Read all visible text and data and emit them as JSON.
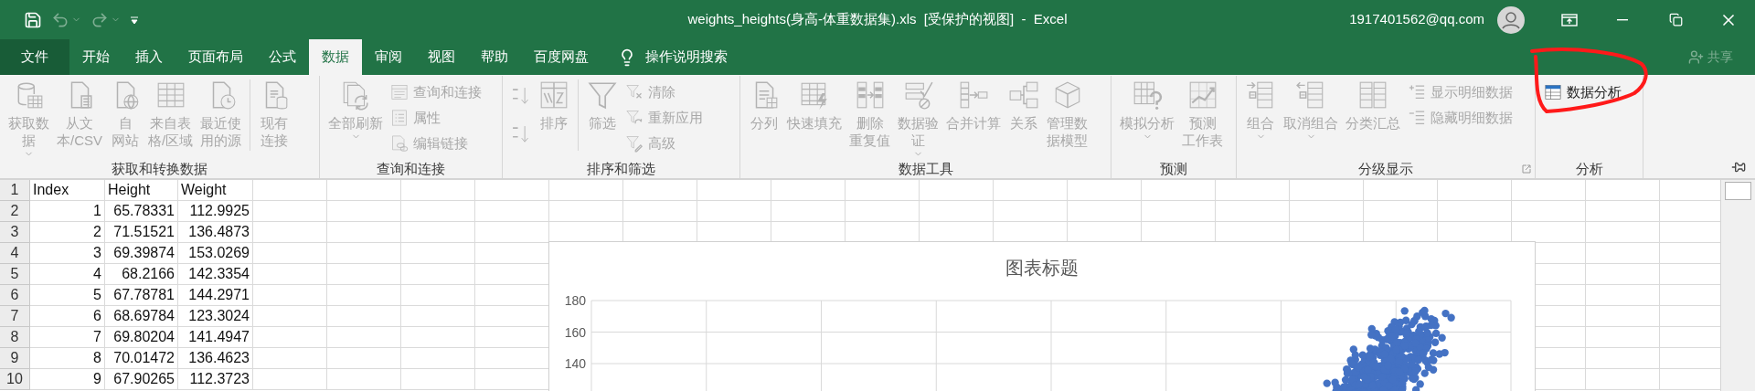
{
  "title_bar": {
    "quick_access": [
      {
        "kind": "save",
        "disabled": false,
        "dropdown": false
      },
      {
        "kind": "undo",
        "disabled": true,
        "dropdown": true
      },
      {
        "kind": "redo",
        "disabled": true,
        "dropdown": true
      },
      {
        "kind": "customize",
        "disabled": false,
        "dropdown": false
      }
    ],
    "title": "weights_heights(身高-体重数据集).xls  [受保护的视图]  -  Excel",
    "account": "1917401562@qq.com"
  },
  "ribbon_tabs": [
    {
      "label": "文件",
      "kind": "file",
      "selected": false
    },
    {
      "label": "开始",
      "kind": "tab",
      "selected": false
    },
    {
      "label": "插入",
      "kind": "tab",
      "selected": false
    },
    {
      "label": "页面布局",
      "kind": "tab",
      "selected": false
    },
    {
      "label": "公式",
      "kind": "tab",
      "selected": false
    },
    {
      "label": "数据",
      "kind": "tab",
      "selected": true
    },
    {
      "label": "审阅",
      "kind": "tab",
      "selected": false
    },
    {
      "label": "视图",
      "kind": "tab",
      "selected": false
    },
    {
      "label": "帮助",
      "kind": "tab",
      "selected": false
    },
    {
      "label": "百度网盘",
      "kind": "tab",
      "selected": false
    }
  ],
  "tell_me": "操作说明搜索",
  "share": {
    "label": "共享",
    "disabled": true
  },
  "ribbon_groups": [
    {
      "label": "获取和转换数据",
      "launcher": false,
      "items": [
        {
          "kind": "large",
          "label": "获取数据",
          "disabled": true,
          "dropdown": true
        },
        {
          "kind": "large",
          "label": "从文本/CSV",
          "disabled": true,
          "dropdown": false
        },
        {
          "kind": "large",
          "label": "自网站",
          "disabled": true,
          "dropdown": false
        },
        {
          "kind": "large",
          "label": "来自表格/区域",
          "disabled": true,
          "dropdown": false
        },
        {
          "kind": "large",
          "label": "最近使用的源",
          "disabled": true,
          "dropdown": false
        },
        {
          "kind": "separator"
        },
        {
          "kind": "large",
          "label": "现有连接",
          "disabled": true,
          "dropdown": false
        }
      ]
    },
    {
      "label": "查询和连接",
      "launcher": false,
      "items": [
        {
          "kind": "large",
          "label": "全部刷新",
          "disabled": true,
          "dropdown": true
        },
        {
          "kind": "stack",
          "buttons": [
            {
              "label": "查询和连接",
              "disabled": true
            },
            {
              "label": "属性",
              "disabled": true
            },
            {
              "label": "编辑链接",
              "disabled": true
            }
          ]
        }
      ]
    },
    {
      "label": "排序和筛选",
      "launcher": false,
      "items": [
        {
          "kind": "stack",
          "buttons": [
            {
              "disabled": true
            },
            {
              "disabled": true
            }
          ]
        },
        {
          "kind": "large",
          "label": "排序",
          "disabled": true,
          "dropdown": false
        },
        {
          "kind": "separator"
        },
        {
          "kind": "large",
          "label": "筛选",
          "disabled": true,
          "dropdown": false
        },
        {
          "kind": "stack",
          "buttons": [
            {
              "label": "清除",
              "disabled": true
            },
            {
              "label": "重新应用",
              "disabled": true
            },
            {
              "label": "高级",
              "disabled": true
            }
          ]
        }
      ]
    },
    {
      "label": "数据工具",
      "launcher": false,
      "items": [
        {
          "kind": "large",
          "label": "分列",
          "disabled": true,
          "dropdown": false
        },
        {
          "kind": "large",
          "label": "快速填充",
          "disabled": true,
          "dropdown": false
        },
        {
          "kind": "large",
          "label": "删除重复值",
          "disabled": true,
          "dropdown": false
        },
        {
          "kind": "large",
          "label": "数据验证",
          "disabled": true,
          "dropdown": true
        },
        {
          "kind": "large",
          "label": "合并计算",
          "disabled": true,
          "dropdown": false
        },
        {
          "kind": "large",
          "label": "关系",
          "disabled": true,
          "dropdown": false
        },
        {
          "kind": "large",
          "label": "管理数据模型",
          "disabled": true,
          "dropdown": false
        }
      ]
    },
    {
      "label": "预测",
      "launcher": false,
      "items": [
        {
          "kind": "large",
          "label": "模拟分析",
          "disabled": true,
          "dropdown": true
        },
        {
          "kind": "large",
          "label": "预测工作表",
          "disabled": true,
          "dropdown": false
        }
      ]
    },
    {
      "label": "分级显示",
      "launcher": true,
      "items": [
        {
          "kind": "large",
          "label": "组合",
          "disabled": true,
          "dropdown": true
        },
        {
          "kind": "large",
          "label": "取消组合",
          "disabled": true,
          "dropdown": true
        },
        {
          "kind": "large",
          "label": "分类汇总",
          "disabled": true,
          "dropdown": false
        },
        {
          "kind": "stack",
          "buttons": [
            {
              "label": "显示明细数据",
              "disabled": true
            },
            {
              "label": "隐藏明细数据",
              "disabled": true
            }
          ]
        }
      ]
    },
    {
      "label": "分析",
      "launcher": false,
      "items": [
        {
          "kind": "stack",
          "buttons": [
            {
              "label": "数据分析",
              "disabled": false
            }
          ]
        }
      ]
    }
  ],
  "sheet": {
    "rows": [
      {
        "number": "1",
        "kind": "header",
        "cells": [
          "Index",
          "Height",
          "Weight"
        ]
      },
      {
        "number": "2",
        "kind": "data",
        "cells": [
          "1",
          "65.78331",
          "112.9925"
        ]
      },
      {
        "number": "3",
        "kind": "data",
        "cells": [
          "2",
          "71.51521",
          "136.4873"
        ]
      },
      {
        "number": "4",
        "kind": "data",
        "cells": [
          "3",
          "69.39874",
          "153.0269"
        ]
      },
      {
        "number": "5",
        "kind": "data",
        "cells": [
          "4",
          "68.2166",
          "142.3354"
        ]
      },
      {
        "number": "6",
        "kind": "data",
        "cells": [
          "5",
          "67.78781",
          "144.2971"
        ]
      },
      {
        "number": "7",
        "kind": "data",
        "cells": [
          "6",
          "68.69784",
          "123.3024"
        ]
      },
      {
        "number": "8",
        "kind": "data",
        "cells": [
          "7",
          "69.80204",
          "141.4947"
        ]
      },
      {
        "number": "9",
        "kind": "data",
        "cells": [
          "8",
          "70.01472",
          "136.4623"
        ]
      },
      {
        "number": "10",
        "kind": "data",
        "cells": [
          "9",
          "67.90265",
          "112.3723"
        ]
      }
    ]
  },
  "chart": {
    "title": "图表标题",
    "y_axis_labels": [
      "180",
      "160",
      "140"
    ]
  }
}
